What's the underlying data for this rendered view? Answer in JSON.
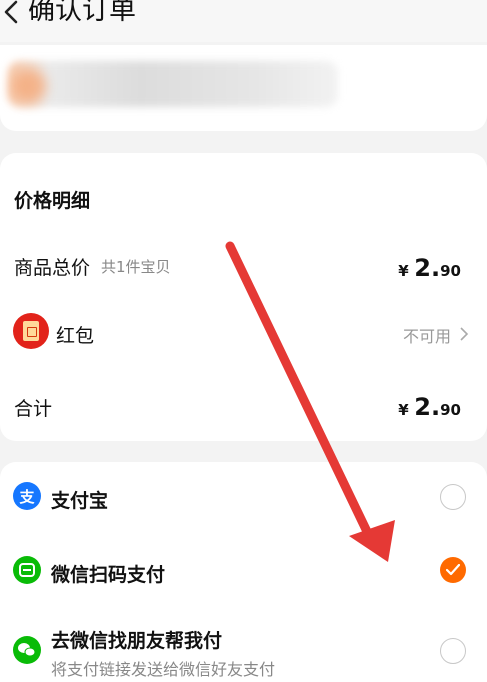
{
  "header": {
    "title": "确认订单"
  },
  "price_card": {
    "title": "价格明细",
    "goods_total_label": "商品总价",
    "goods_total_sub": "共1件宝贝",
    "goods_total_currency": "¥",
    "goods_total_int": "2.",
    "goods_total_dec": "90",
    "redpacket_label": "红包",
    "redpacket_status": "不可用",
    "sum_label": "合计",
    "sum_currency": "¥",
    "sum_int": "2.",
    "sum_dec": "90"
  },
  "payment": {
    "alipay": "支付宝",
    "wechat_scan": "微信扫码支付",
    "wechat_friend": "去微信找朋友帮我付",
    "wechat_friend_sub": "将支付链接发送给微信好友支付",
    "selected": "wechat_scan"
  },
  "colors": {
    "accent": "#ff6a00",
    "arrow": "#e53935",
    "alipay": "#1677ff",
    "wechat": "#09bb07",
    "redpacket": "#e2231a"
  }
}
